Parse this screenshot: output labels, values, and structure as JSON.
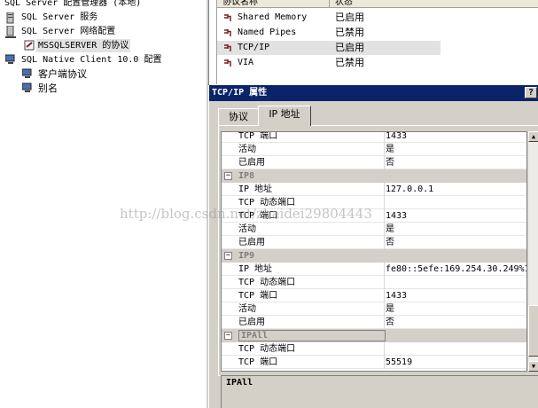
{
  "tree": {
    "root": "SQL Server 配置管理器 (本地)",
    "services": "SQL Server 服务",
    "network": "SQL Server 网络配置",
    "protocols": "MSSQLSERVER 的协议",
    "native": "SQL Native Client 10.0 配置",
    "client_protocols": "客户端协议",
    "aliases": "别名"
  },
  "list": {
    "col_name": "协议名称",
    "col_state": "状态",
    "rows": [
      {
        "name": "Shared Memory",
        "state": "已启用"
      },
      {
        "name": "Named Pipes",
        "state": "已禁用"
      },
      {
        "name": "TCP/IP",
        "state": "已启用"
      },
      {
        "name": "VIA",
        "state": "已禁用"
      }
    ]
  },
  "dialog": {
    "title": "TCP/IP 属性",
    "help": "?",
    "tabs": [
      "协议",
      "IP 地址"
    ],
    "grid": [
      {
        "type": "row",
        "k": "TCP 端口",
        "v": "1433"
      },
      {
        "type": "row",
        "k": "活动",
        "v": "是"
      },
      {
        "type": "row",
        "k": "已启用",
        "v": "否"
      },
      {
        "type": "cat",
        "k": "IP8"
      },
      {
        "type": "row",
        "k": "IP 地址",
        "v": "127.0.0.1"
      },
      {
        "type": "row",
        "k": "TCP 动态端口",
        "v": ""
      },
      {
        "type": "row",
        "k": "TCP 端口",
        "v": "1433"
      },
      {
        "type": "row",
        "k": "活动",
        "v": "是"
      },
      {
        "type": "row",
        "k": "已启用",
        "v": "否"
      },
      {
        "type": "cat",
        "k": "IP9"
      },
      {
        "type": "row",
        "k": "IP 地址",
        "v": "fe80::5efe:169.254.30.249%1"
      },
      {
        "type": "row",
        "k": "TCP 动态端口",
        "v": ""
      },
      {
        "type": "row",
        "k": "TCP 端口",
        "v": "1433"
      },
      {
        "type": "row",
        "k": "活动",
        "v": "是"
      },
      {
        "type": "row",
        "k": "已启用",
        "v": "否"
      },
      {
        "type": "cat",
        "k": "IPAll",
        "selected": true
      },
      {
        "type": "row",
        "k": "TCP 动态端口",
        "v": ""
      },
      {
        "type": "row",
        "k": "TCP 端口",
        "v": "55519"
      }
    ],
    "description": "IPAll"
  },
  "watermark": "http://blog.csdn.net/zhaidei29804443"
}
